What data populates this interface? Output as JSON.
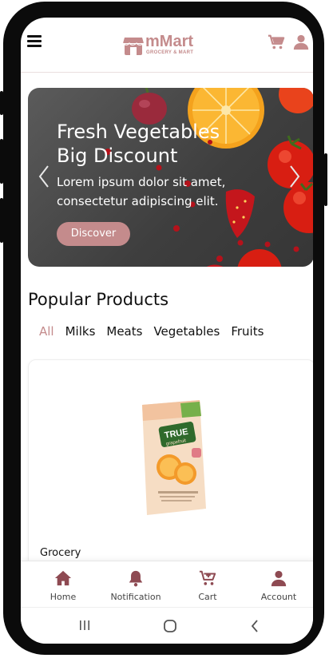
{
  "app": {
    "name": "mMart",
    "tagline": "GROCERY & MART",
    "accent_color": "#c48b8c"
  },
  "header": {
    "menu_icon": "hamburger-menu-icon",
    "cart_icon": "cart-icon",
    "account_icon": "user-icon"
  },
  "banner": {
    "title_line1": "Fresh Vegetables",
    "title_line2": "Big Discount",
    "text": "Lorem ipsum dolor sit amet, consectetur adipiscing elit.",
    "button_label": "Discover"
  },
  "popular": {
    "title": "Popular Products",
    "tabs": [
      {
        "label": "All",
        "active": true
      },
      {
        "label": "Milks",
        "active": false
      },
      {
        "label": "Meats",
        "active": false
      },
      {
        "label": "Vegetables",
        "active": false
      },
      {
        "label": "Fruits",
        "active": false
      }
    ],
    "product": {
      "category": "Grocery",
      "package_brand": "TRUE",
      "package_flavor": "grapefruit"
    }
  },
  "bottom_nav": {
    "items": [
      {
        "label": "Home",
        "icon": "home-icon"
      },
      {
        "label": "Notification",
        "icon": "bell-icon"
      },
      {
        "label": "Cart",
        "icon": "cart-add-icon"
      },
      {
        "label": "Account",
        "icon": "user-icon"
      }
    ]
  },
  "system_nav": {
    "icons": [
      "recent-apps-icon",
      "home-circle-icon",
      "back-icon"
    ]
  }
}
